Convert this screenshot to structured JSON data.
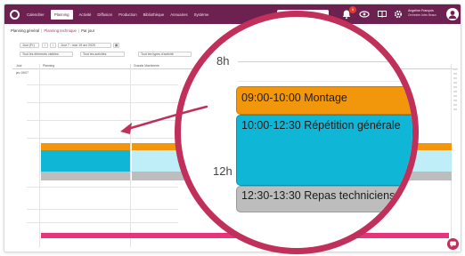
{
  "nav": {
    "items": [
      "Calendrier",
      "Planning",
      "Activité",
      "Diffusion",
      "Production",
      "Bibliothèque",
      "Annuaires",
      "Système"
    ],
    "active_index": 1
  },
  "notifications": {
    "count": "5"
  },
  "user": {
    "name": "Angeline François",
    "organization": "Orchestre Arles Beaux"
  },
  "breadcrumb": [
    "Planning général",
    "Planning technique",
    "Par jour"
  ],
  "toolbar": {
    "view_label": "Jour (Fr)",
    "date_label": "Jour 7 : mar 19 avr 2020",
    "filter_1": "Tout les éléments visibles",
    "filter_2": "Tout les activités",
    "filter_3": "Tout les types d'activité"
  },
  "grid": {
    "columns": [
      "Jour",
      "Planning",
      "Grande Machinerie"
    ],
    "day_label": "jeu 19/07"
  },
  "magnifier": {
    "hour_8": "8h",
    "hour_12": "12h",
    "events": [
      {
        "label": "09:00-10:00 Montage",
        "color": "#f2960c"
      },
      {
        "label": "10:00-12:30 Répétition générale",
        "color": "#10b6d6"
      },
      {
        "label": "12:30-13:30 Repas techniciens",
        "color": "#bdbdbd"
      }
    ]
  }
}
